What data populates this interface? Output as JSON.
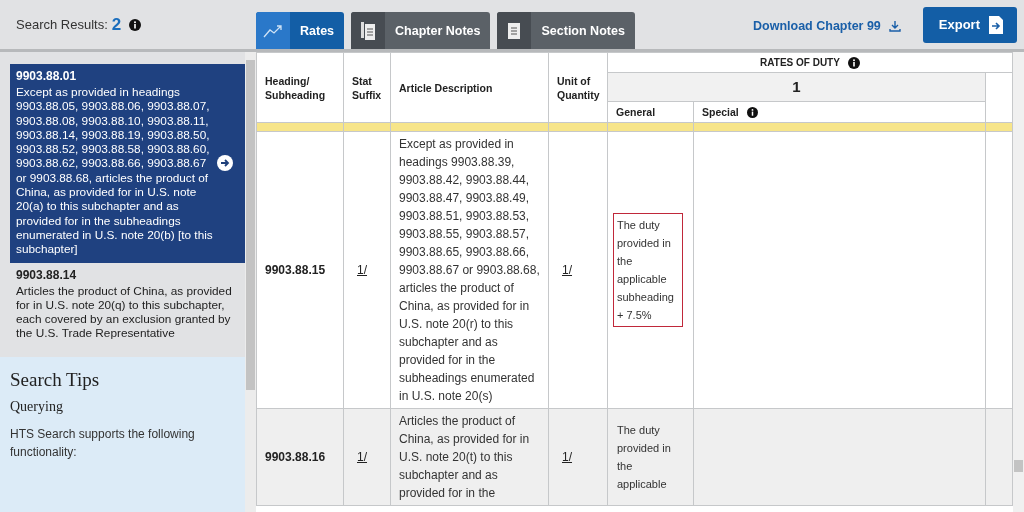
{
  "search_results": {
    "label": "Search Results:",
    "count": "2"
  },
  "tabs": [
    {
      "label": "Rates",
      "kind": "chart",
      "selected": true
    },
    {
      "label": "Chapter Notes",
      "kind": "pages",
      "selected": false
    },
    {
      "label": "Section Notes",
      "kind": "page",
      "selected": false
    }
  ],
  "download_link": "Download Chapter 99",
  "export_button": "Export",
  "results": [
    {
      "code": "9903.88.01",
      "text": "Except as provided in headings 9903.88.05, 9903.88.06, 9903.88.07, 9903.88.08, 9903.88.10, 9903.88.11, 9903.88.14, 9903.88.19, 9903.88.50, 9903.88.52, 9903.88.58, 9903.88.60, 9903.88.62, 9903.88.66, 9903.88.67 or 9903.88.68, articles the product of China, as provided for in U.S. note 20(a) to this subchapter and as provided for in the subheadings enumerated in U.S. note 20(b) [to this subchapter]",
      "selected": true
    },
    {
      "code": "9903.88.14",
      "text": "Articles the product of China, as provided for in U.S. note 20(q) to this subchapter, each covered by an exclusion granted by the U.S. Trade Representative",
      "selected": false
    }
  ],
  "search_tips": {
    "title": "Search Tips",
    "subtitle": "Querying",
    "text": "HTS Search supports the following functionality:"
  },
  "table": {
    "columns": [
      "Heading/ Subheading",
      "Stat Suffix",
      "Article Description",
      "Unit of Quantity"
    ],
    "rates_header": "RATES OF DUTY",
    "column_group": "1",
    "rate_columns": [
      "General",
      "Special"
    ],
    "highlighted_strip": true,
    "rows": [
      {
        "heading": "9903.88.15",
        "stat_suffix": "1/",
        "description": "Except as provided in headings 9903.88.39, 9903.88.42, 9903.88.44, 9903.88.47, 9903.88.49, 9903.88.51, 9903.88.53, 9903.88.55, 9903.88.57, 9903.88.65, 9903.88.66, 9903.88.67 or 9903.88.68, articles the product of China, as provided for in U.S. note 20(r) to this subchapter and as provided for in the subheadings enumerated in U.S. note 20(s)",
        "unit": "1/",
        "general": "The duty provided in the applicable subheading + 7.5%",
        "general_outlined": true
      },
      {
        "heading": "9903.88.16",
        "stat_suffix": "1/",
        "description": "Articles the product of China, as provided for in U.S. note 20(t) to this subchapter and as provided for in the",
        "unit": "1/",
        "general": "The duty provided in the applicable",
        "general_outlined": false
      }
    ]
  }
}
